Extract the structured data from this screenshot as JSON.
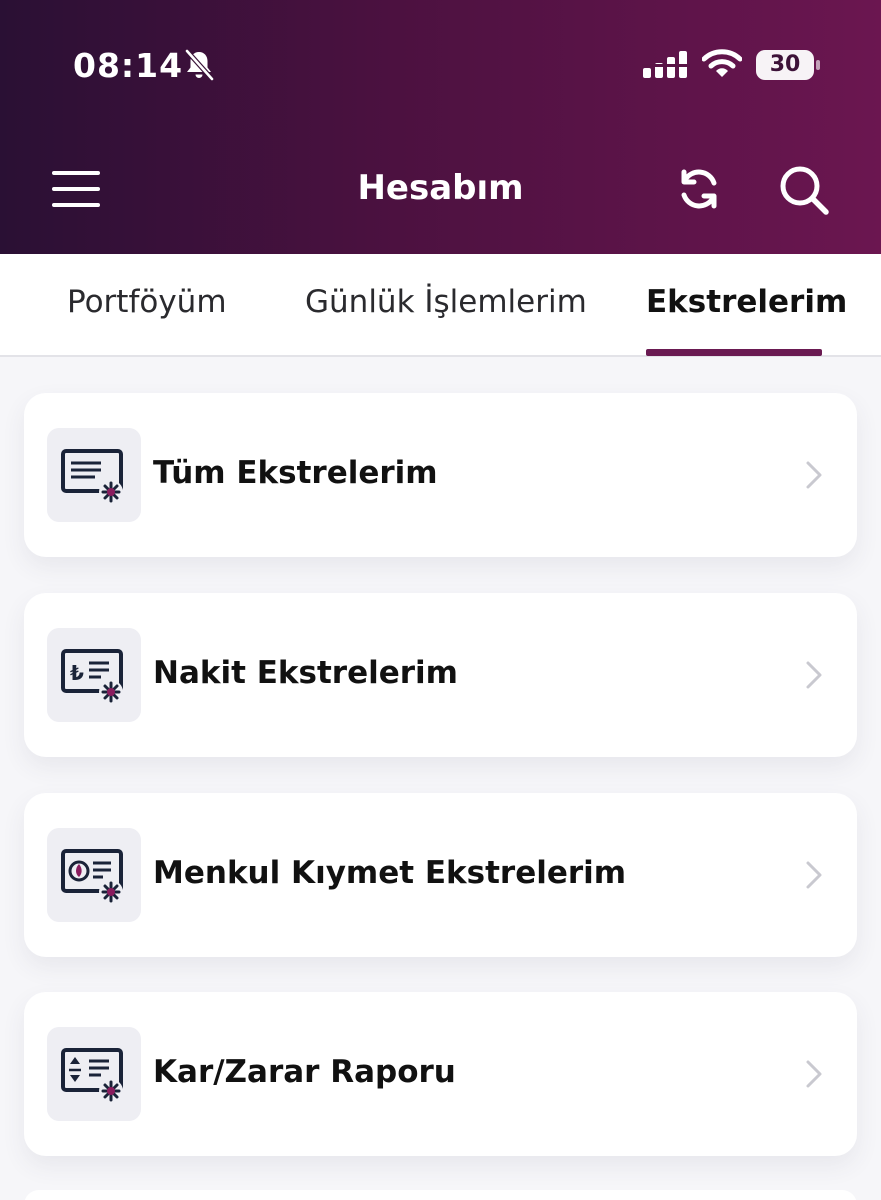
{
  "status_bar": {
    "time": "08:14",
    "battery": "30",
    "icons": [
      "bell-slash-icon",
      "signal-icon",
      "wifi-icon",
      "battery-icon"
    ]
  },
  "header": {
    "title": "Hesabım",
    "menu_icon": "hamburger-menu-icon",
    "refresh_icon": "refresh-icon",
    "search_icon": "search-icon"
  },
  "tabs": [
    {
      "label": "Portföyüm",
      "active": false
    },
    {
      "label": "Günlük İşlemlerim",
      "active": false
    },
    {
      "label": "Ekstrelerim",
      "active": true
    }
  ],
  "menu_items": [
    {
      "label": "Tüm Ekstrelerim",
      "icon": "all-statements-icon"
    },
    {
      "label": "Nakit Ekstrelerim",
      "icon": "cash-statements-icon"
    },
    {
      "label": "Menkul Kıymet Ekstrelerim",
      "icon": "securities-statements-icon"
    },
    {
      "label": "Kar/Zarar Raporu",
      "icon": "profit-loss-report-icon"
    }
  ],
  "colors": {
    "header_start": "#2a1034",
    "header_end": "#6b1650",
    "accent": "#6a1a52",
    "icon_navy": "#1a2338",
    "icon_magenta": "#8a1c5e"
  }
}
